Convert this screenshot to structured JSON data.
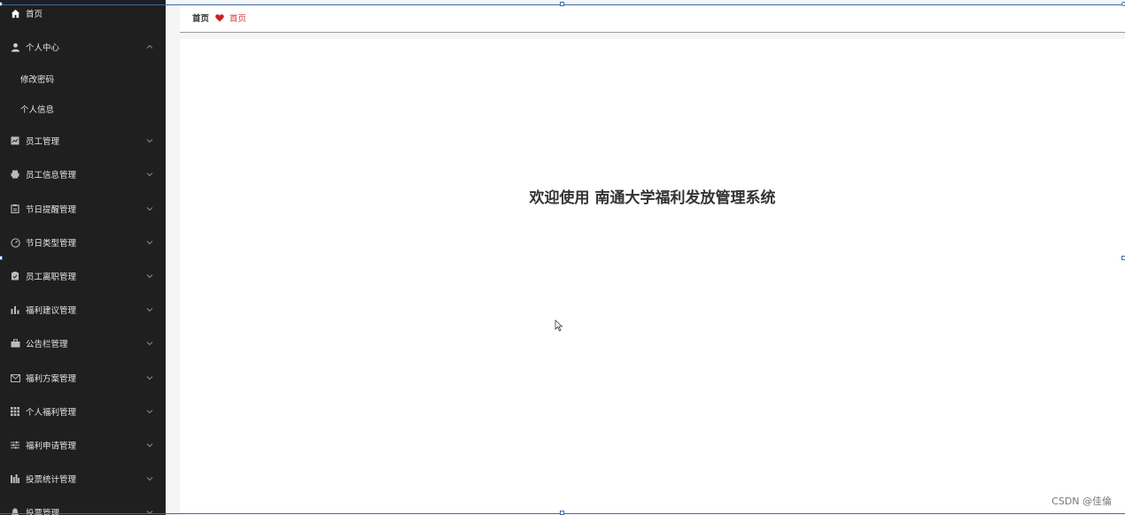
{
  "breadcrumb": {
    "home": "首页",
    "current": "首页"
  },
  "welcome_text": "欢迎使用 南通大学福利发放管理系统",
  "watermark": "CSDN @佳倫",
  "colors": {
    "sidebar_bg": "#1f1f1f",
    "accent_red": "#d13b2e",
    "frame_blue": "#3d6aa8"
  },
  "sidebar": {
    "home": {
      "label": "首页",
      "icon": "home-icon"
    },
    "personal_center": {
      "label": "个人中心",
      "icon": "user-icon",
      "expanded": true,
      "children": [
        {
          "label": "修改密码"
        },
        {
          "label": "个人信息"
        }
      ]
    },
    "items": [
      {
        "label": "员工管理",
        "icon": "id-card-icon"
      },
      {
        "label": "员工信息管理",
        "icon": "printer-icon"
      },
      {
        "label": "节日提醒管理",
        "icon": "clipboard-icon"
      },
      {
        "label": "节日类型管理",
        "icon": "gauge-icon"
      },
      {
        "label": "员工离职管理",
        "icon": "clipboard-check-icon"
      },
      {
        "label": "福利建议管理",
        "icon": "bar-chart-icon"
      },
      {
        "label": "公告栏管理",
        "icon": "briefcase-icon"
      },
      {
        "label": "福利方案管理",
        "icon": "mail-icon"
      },
      {
        "label": "个人福利管理",
        "icon": "grid-icon"
      },
      {
        "label": "福利申请管理",
        "icon": "sliders-icon"
      },
      {
        "label": "投票统计管理",
        "icon": "stats-icon"
      },
      {
        "label": "投票管理",
        "icon": "bell-icon"
      }
    ]
  }
}
